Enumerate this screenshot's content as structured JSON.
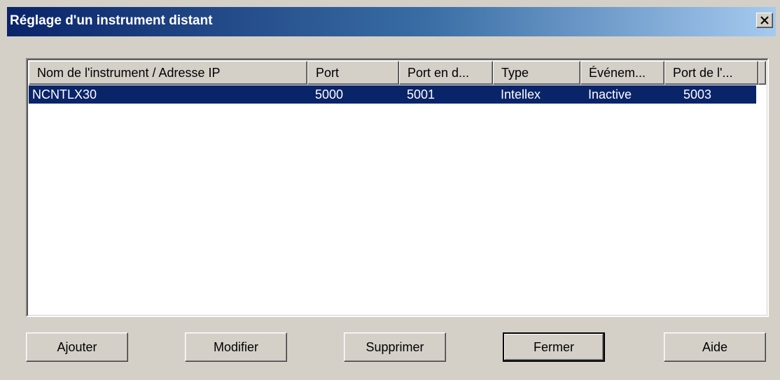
{
  "window": {
    "title": "Réglage d'un instrument distant",
    "close_label": "close"
  },
  "list": {
    "columns": [
      "Nom de l'instrument / Adresse IP",
      "Port",
      "Port en d...",
      "Type",
      "Événem...",
      "Port de l'..."
    ],
    "rows": [
      {
        "name": "NCNTLX30",
        "port": "5000",
        "port_en": "5001",
        "type": "Intellex",
        "event": "Inactive",
        "port_de": "5003",
        "selected": true
      }
    ]
  },
  "buttons": {
    "add": "Ajouter",
    "modify": "Modifier",
    "delete": "Supprimer",
    "close": "Fermer",
    "help": "Aide"
  },
  "colors": {
    "selection": "#0a246a",
    "titlebar_start": "#0a246a",
    "titlebar_end": "#a6caf0",
    "face": "#d4d0c8"
  },
  "icons": {
    "close": "close-icon"
  }
}
